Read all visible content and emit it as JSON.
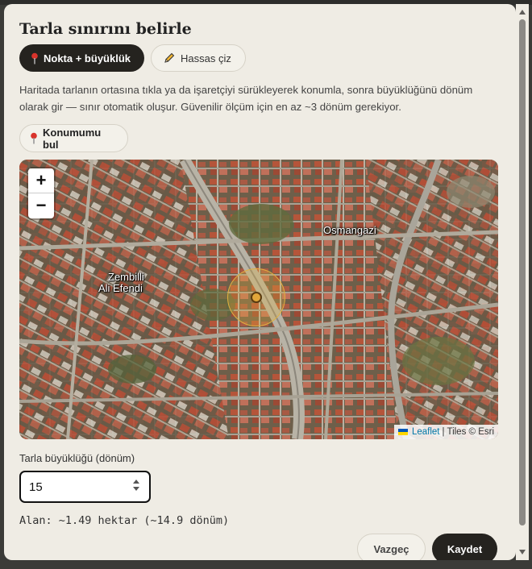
{
  "dialog": {
    "title": "Tarla sınırını belirle",
    "modes": [
      {
        "label": "Nokta + büyüklük",
        "icon": "pin-icon",
        "active": true
      },
      {
        "label": "Hassas çiz",
        "icon": "pencil-icon",
        "active": false
      }
    ],
    "description": "Haritada tarlanın ortasına tıkla ya da işaretçiyi sürükleyerek konumla, sonra büyüklüğünü dönüm olarak gir — sınır otomatik oluşur. Güvenilir ölçüm için en az ~3 dönüm gerekiyor.",
    "locate_label": "Konumumu bul"
  },
  "map": {
    "zoom_in": "+",
    "zoom_out": "−",
    "labels": [
      "Osmangazi",
      "Zembilli",
      "Ali Efendi"
    ],
    "attribution": {
      "link": "Leaflet",
      "rest": "| Tiles © Esri"
    },
    "marker_color": "#e1a63a"
  },
  "form": {
    "size_label": "Tarla büyüklüğü (dönüm)",
    "size_value": "15",
    "area_text": "Alan: ~1.49 hektar (~14.9 dönüm)"
  },
  "actions": {
    "cancel": "Vazgeç",
    "save": "Kaydet"
  }
}
